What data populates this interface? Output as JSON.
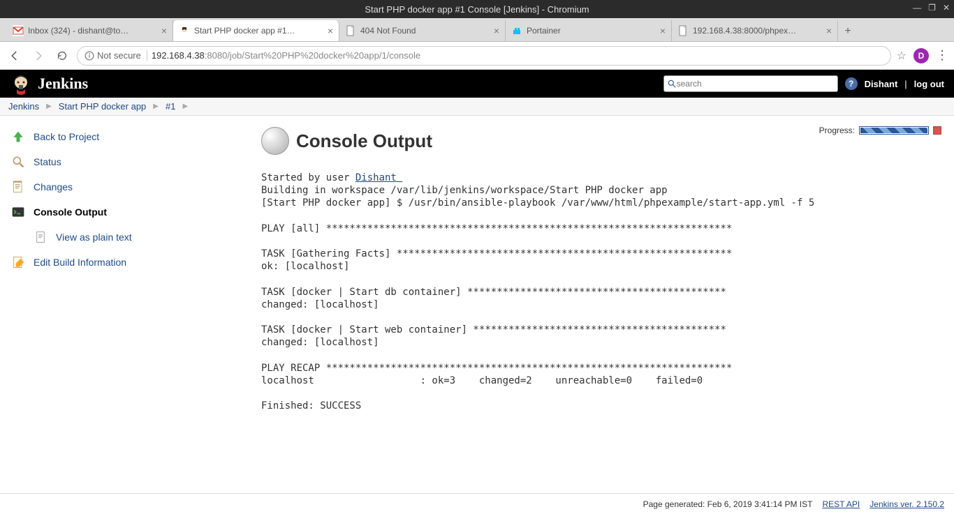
{
  "window": {
    "title": "Start PHP docker app #1 Console [Jenkins] - Chromium"
  },
  "tabs": [
    {
      "title": "Inbox (324) - dishant@to…",
      "active": false
    },
    {
      "title": "Start PHP docker app #1…",
      "active": true
    },
    {
      "title": "404 Not Found",
      "active": false
    },
    {
      "title": "Portainer",
      "active": false
    },
    {
      "title": "192.168.4.38:8000/phpex…",
      "active": false
    }
  ],
  "address": {
    "not_secure": "Not secure",
    "host": "192.168.4.38",
    "port_path": ":8080/job/Start%20PHP%20docker%20app/1/console",
    "avatar_letter": "D"
  },
  "header": {
    "logo_text": "Jenkins",
    "search_placeholder": "search",
    "user": "Dishant",
    "logout": "log out"
  },
  "breadcrumbs": [
    "Jenkins",
    "Start PHP docker app",
    "#1"
  ],
  "sidebar": {
    "back": "Back to Project",
    "status": "Status",
    "changes": "Changes",
    "console": "Console Output",
    "plaintext": "View as plain text",
    "edit": "Edit Build Information"
  },
  "content": {
    "progress_label": "Progress:",
    "page_title": "Console Output",
    "started_by_prefix": "Started by user ",
    "started_by_user": "Dishant ",
    "log_rest": "Building in workspace /var/lib/jenkins/workspace/Start PHP docker app\n[Start PHP docker app] $ /usr/bin/ansible-playbook /var/www/html/phpexample/start-app.yml -f 5\n\nPLAY [all] *********************************************************************\n\nTASK [Gathering Facts] *********************************************************\nok: [localhost]\n\nTASK [docker | Start db container] ********************************************\nchanged: [localhost]\n\nTASK [docker | Start web container] *******************************************\nchanged: [localhost]\n\nPLAY RECAP *********************************************************************\nlocalhost                  : ok=3    changed=2    unreachable=0    failed=0\n\nFinished: SUCCESS"
  },
  "footer": {
    "generated": "Page generated: Feb 6, 2019 3:41:14 PM IST",
    "rest_api": "REST API",
    "version": "Jenkins ver. 2.150.2"
  }
}
